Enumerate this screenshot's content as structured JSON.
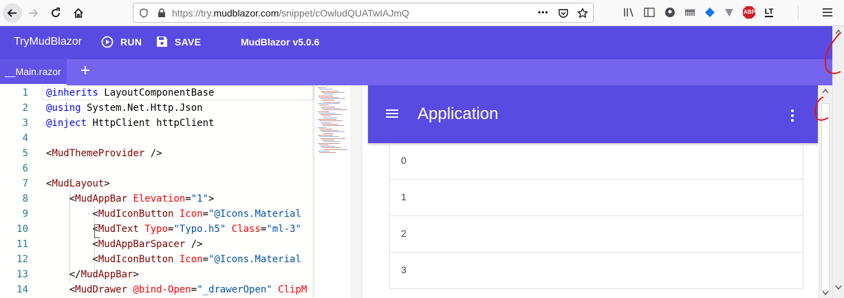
{
  "browser": {
    "url_prefix": "https://try.",
    "url_host": "mudblazor.com",
    "url_path": "/snippet/cOwludQUATwIAJmQ",
    "more_label": "•••",
    "toolbar_icons": [
      "library-icon",
      "sidebar-icon",
      "account-icon",
      "extensions-icon",
      "diamond-icon",
      "tracker-icon",
      "adblock-icon",
      "languagetool-icon",
      "menu-icon"
    ],
    "abp_label": "ABP",
    "lt_label": "LT"
  },
  "appbar": {
    "title": "TryMudBlazor",
    "run_label": "RUN",
    "save_label": "SAVE",
    "version": "MudBlazor v5.0.6",
    "color": "#594ae2"
  },
  "tabs": {
    "active_tab": "__Main.razor",
    "add_label": "+"
  },
  "editor": {
    "line_numbers": [
      "1",
      "2",
      "3",
      "4",
      "5",
      "6",
      "7",
      "8",
      "9",
      "10",
      "11",
      "12",
      "13",
      "14"
    ],
    "lines": [
      [
        {
          "t": "@inherits",
          "c": "kw"
        },
        {
          "t": " LayoutComponentBase",
          "c": ""
        }
      ],
      [
        {
          "t": "@using",
          "c": "kw"
        },
        {
          "t": " System.Net.Http.Json",
          "c": ""
        }
      ],
      [
        {
          "t": "@inject",
          "c": "kw"
        },
        {
          "t": " HttpClient httpClient",
          "c": ""
        }
      ],
      [],
      [
        {
          "t": "<",
          "c": ""
        },
        {
          "t": "MudThemeProvider",
          "c": "tag"
        },
        {
          "t": " />",
          "c": ""
        }
      ],
      [],
      [
        {
          "t": "<",
          "c": ""
        },
        {
          "t": "MudLayout",
          "c": "tag"
        },
        {
          "t": ">",
          "c": ""
        }
      ],
      [
        {
          "t": "    <",
          "c": ""
        },
        {
          "t": "MudAppBar",
          "c": "tag"
        },
        {
          "t": " ",
          "c": ""
        },
        {
          "t": "Elevation",
          "c": "attr"
        },
        {
          "t": "=",
          "c": ""
        },
        {
          "t": "\"1\"",
          "c": "str"
        },
        {
          "t": ">",
          "c": ""
        }
      ],
      [
        {
          "t": "        <",
          "c": ""
        },
        {
          "t": "MudIconButton",
          "c": "tag"
        },
        {
          "t": " ",
          "c": ""
        },
        {
          "t": "Icon",
          "c": "attr"
        },
        {
          "t": "=",
          "c": ""
        },
        {
          "t": "\"@Icons.Material",
          "c": "str"
        }
      ],
      [
        {
          "t": "        <",
          "c": ""
        },
        {
          "t": "MudText",
          "c": "tag"
        },
        {
          "t": " ",
          "c": ""
        },
        {
          "t": "Typo",
          "c": "attr"
        },
        {
          "t": "=",
          "c": ""
        },
        {
          "t": "\"Typo.h5\"",
          "c": "str"
        },
        {
          "t": " ",
          "c": ""
        },
        {
          "t": "Class",
          "c": "attr"
        },
        {
          "t": "=",
          "c": ""
        },
        {
          "t": "\"ml-3\"",
          "c": "str"
        }
      ],
      [
        {
          "t": "        <",
          "c": ""
        },
        {
          "t": "MudAppBarSpacer",
          "c": "tag"
        },
        {
          "t": " />",
          "c": ""
        }
      ],
      [
        {
          "t": "        <",
          "c": ""
        },
        {
          "t": "MudIconButton",
          "c": "tag"
        },
        {
          "t": " ",
          "c": ""
        },
        {
          "t": "Icon",
          "c": "attr"
        },
        {
          "t": "=",
          "c": ""
        },
        {
          "t": "\"@Icons.Material",
          "c": "str"
        }
      ],
      [
        {
          "t": "    </",
          "c": ""
        },
        {
          "t": "MudAppBar",
          "c": "tag"
        },
        {
          "t": ">",
          "c": ""
        }
      ],
      [
        {
          "t": "    <",
          "c": ""
        },
        {
          "t": "MudDrawer",
          "c": "tag"
        },
        {
          "t": " ",
          "c": ""
        },
        {
          "t": "@bind-Open",
          "c": "attr"
        },
        {
          "t": "=",
          "c": ""
        },
        {
          "t": "\"_drawerOpen\"",
          "c": "str"
        },
        {
          "t": " ",
          "c": ""
        },
        {
          "t": "ClipM",
          "c": "attr"
        }
      ]
    ]
  },
  "preview": {
    "title": "Application",
    "rows": [
      "0",
      "1",
      "2",
      "3"
    ]
  }
}
